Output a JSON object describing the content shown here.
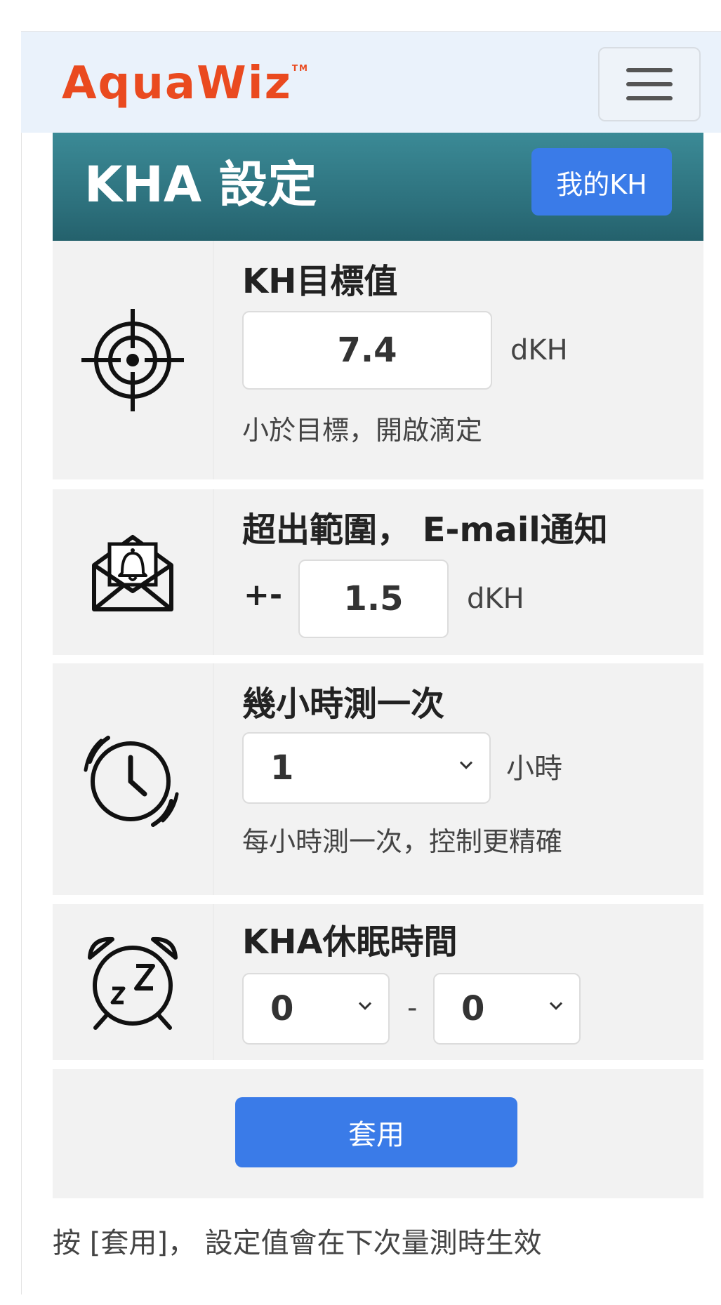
{
  "navbar": {
    "logo_text": "AquaWiz",
    "logo_tm": "TM",
    "menu_icon": "hamburger-menu-icon"
  },
  "header": {
    "title": "KHA 設定",
    "my_kh_button": "我的KH"
  },
  "target": {
    "icon": "target-crosshair-icon",
    "label": "KH目標值",
    "value": "7.4",
    "unit": "dKH",
    "hint": "小於目標，開啟滴定"
  },
  "alert": {
    "icon": "email-bell-icon",
    "label_prefix": "超出範圍，",
    "label_suffix": "E-mail通知",
    "plus_minus": "+-",
    "value": "1.5",
    "unit": "dKH"
  },
  "interval": {
    "icon": "clock-icon",
    "label": "幾小時測一次",
    "selected": "1",
    "unit": "小時",
    "hint": "每小時測一次，控制更精確"
  },
  "sleep": {
    "icon": "alarm-clock-sleep-icon",
    "label": "KHA休眠時間",
    "start_selected": "0",
    "separator": "-",
    "end_selected": "0"
  },
  "apply": {
    "button_label": "套用"
  },
  "footer": {
    "note": "按 [套用]， 設定值會在下次量測時生效"
  },
  "colors": {
    "logo": "#ea4a1f",
    "primary_button": "#3a7be8",
    "header_teal": "#2c6f7b",
    "navbar_bg": "#eaf2fb",
    "card_bg": "#f2f2f2"
  }
}
